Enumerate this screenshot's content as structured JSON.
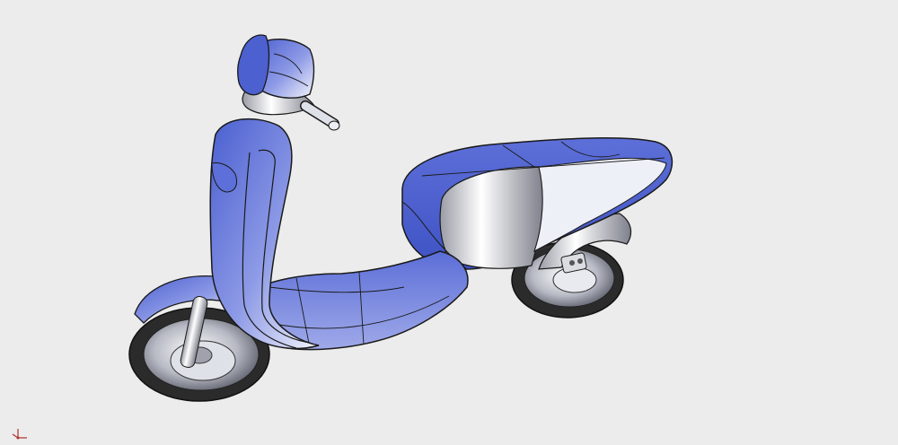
{
  "viewport": {
    "background": "#ececec",
    "model": {
      "shading": "shaded-with-edges",
      "body_color": "#5a6fd6",
      "highlight_color": "#ffffff",
      "edge_color": "#1a1a1a",
      "tire_color": "#2b2b2b"
    },
    "triad": {
      "icon": "axis-triad-icon",
      "color": "#b03030"
    }
  }
}
